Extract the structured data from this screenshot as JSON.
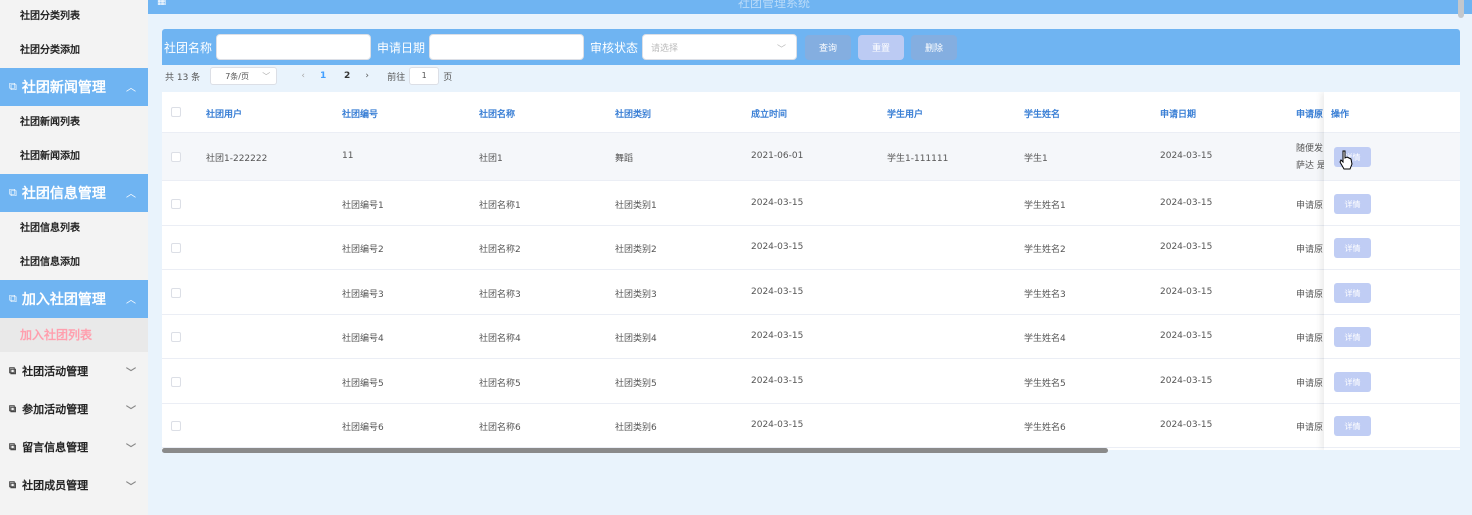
{
  "header": {
    "title": "社团管理系统"
  },
  "sidebar": {
    "top_subs": [
      "社团分类列表",
      "社团分类添加"
    ],
    "groups": [
      {
        "label": "社团新闻管理",
        "subs": [
          "社团新闻列表",
          "社团新闻添加"
        ]
      },
      {
        "label": "社团信息管理",
        "subs": [
          "社团信息列表",
          "社团信息添加"
        ]
      },
      {
        "label": "加入社团管理",
        "subs": [
          "加入社团列表"
        ]
      }
    ],
    "items": [
      "社团活动管理",
      "参加活动管理",
      "留言信息管理",
      "社团成员管理"
    ]
  },
  "search": {
    "label_name": "社团名称",
    "label_date": "申请日期",
    "label_status": "审核状态",
    "status_placeholder": "请选择",
    "btn_query": "查询",
    "btn_reset": "重置",
    "btn_delete": "删除"
  },
  "pager": {
    "total": "共 13 条",
    "page_size": "7条/页",
    "pages": [
      "1",
      "2"
    ],
    "goto": "前往",
    "goto_value": "1",
    "page_unit": "页"
  },
  "table": {
    "columns": [
      "社团用户",
      "社团编号",
      "社团名称",
      "社团类别",
      "成立时间",
      "学生用户",
      "学生姓名",
      "申请日期",
      "申请原",
      "操作"
    ],
    "rows": [
      [
        "社团1-222222",
        "11",
        "社团1",
        "舞蹈",
        "2021-06-01",
        "学生1-111111",
        "学生1",
        "2024-03-15",
        "随便发"
      ],
      [
        "",
        "社团编号1",
        "社团名称1",
        "社团类别1",
        "2024-03-15",
        "",
        "学生姓名1",
        "2024-03-15",
        "申请原"
      ],
      [
        "",
        "社团编号2",
        "社团名称2",
        "社团类别2",
        "2024-03-15",
        "",
        "学生姓名2",
        "2024-03-15",
        "申请原"
      ],
      [
        "",
        "社团编号3",
        "社团名称3",
        "社团类别3",
        "2024-03-15",
        "",
        "学生姓名3",
        "2024-03-15",
        "申请原"
      ],
      [
        "",
        "社团编号4",
        "社团名称4",
        "社团类别4",
        "2024-03-15",
        "",
        "学生姓名4",
        "2024-03-15",
        "申请原"
      ],
      [
        "",
        "社团编号5",
        "社团名称5",
        "社团类别5",
        "2024-03-15",
        "",
        "学生姓名5",
        "2024-03-15",
        "申请原"
      ],
      [
        "",
        "社团编号6",
        "社团名称6",
        "社团类别6",
        "2024-03-15",
        "",
        "学生姓名6",
        "2024-03-15",
        "申请原"
      ]
    ],
    "first_row_reason_line2": "萨达 是",
    "detail_label": "详情"
  },
  "icons": {
    "group": "external-link-icon",
    "chevron": "chevron-icon"
  }
}
